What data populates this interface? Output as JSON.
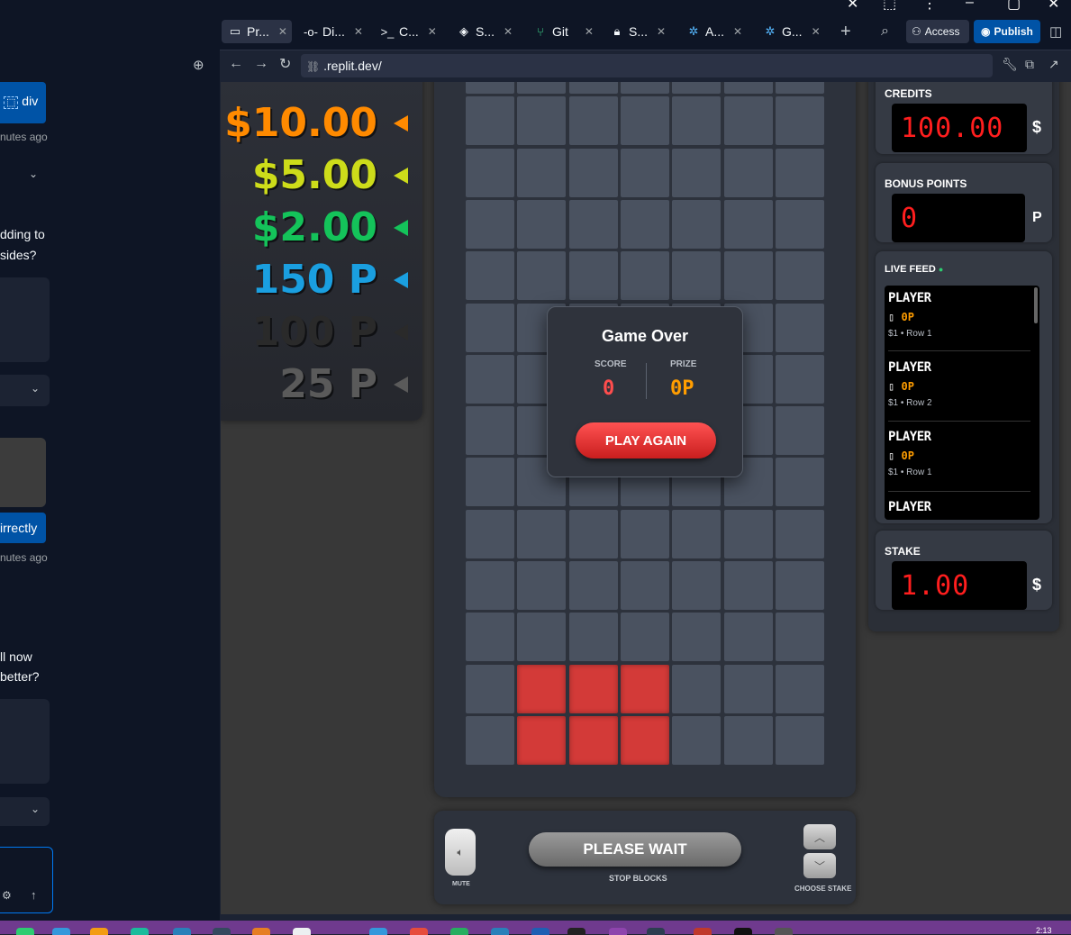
{
  "left_panel": {
    "element_chip": "div",
    "timestamp_1": "nutes ago",
    "message_1_line1": "dding to",
    "message_1_line2": "sides?",
    "reply_button": "irrectly",
    "timestamp_2": "nutes ago",
    "message_2_line1": "ll now",
    "message_2_line2": "better?"
  },
  "tabs": [
    {
      "label": "Pr...",
      "icon": "monitor-icon",
      "active": true
    },
    {
      "label": "Di...",
      "icon": "commit-icon"
    },
    {
      "label": "C...",
      "icon": "terminal-icon"
    },
    {
      "label": "S...",
      "icon": "shield-icon"
    },
    {
      "label": "Git",
      "icon": "git-icon"
    },
    {
      "label": "S...",
      "icon": "lock-icon"
    },
    {
      "label": "A...",
      "icon": "gear-icon"
    },
    {
      "label": "G...",
      "icon": "gear-icon"
    }
  ],
  "header": {
    "access_label": "Access",
    "publish_label": "Publish"
  },
  "address": {
    "url": ".replit.dev/"
  },
  "prizes": [
    {
      "label": "$10.00",
      "color": "#ff8a00"
    },
    {
      "label": "$5.00",
      "color": "#cddc1a"
    },
    {
      "label": "$2.00",
      "color": "#14c35a"
    },
    {
      "label": "150 P",
      "color": "#1a9fe0"
    },
    {
      "label": "100 P",
      "color": "#2a2a2a"
    },
    {
      "label": "25 P",
      "color": "#5a5a5a"
    }
  ],
  "board": {
    "cols": 7,
    "rows": 14,
    "lit_cells": [
      [
        12,
        1
      ],
      [
        12,
        2
      ],
      [
        12,
        3
      ],
      [
        13,
        1
      ],
      [
        13,
        2
      ],
      [
        13,
        3
      ]
    ]
  },
  "game_over": {
    "title": "Game Over",
    "score_label": "SCORE",
    "score_value": "0",
    "prize_label": "PRIZE",
    "prize_value": "0P",
    "play_again": "PLAY AGAIN"
  },
  "sidebar": {
    "credits_label": "CREDITS",
    "credits_value": "100.00",
    "credits_unit": "$",
    "bonus_label": "BONUS POINTS",
    "bonus_value": "0",
    "bonus_unit": "P",
    "feed_label": "LIVE FEED",
    "feed": [
      {
        "player": "PLAYER",
        "prize": "0P",
        "detail": "$1 • Row 1"
      },
      {
        "player": "PLAYER",
        "prize": "0P",
        "detail": "$1 • Row 2"
      },
      {
        "player": "PLAYER",
        "prize": "0P",
        "detail": "$1 • Row 1"
      },
      {
        "player": "PLAYER",
        "prize": "",
        "detail": ""
      }
    ],
    "stake_label": "STAKE",
    "stake_value": "1.00",
    "stake_unit": "$"
  },
  "controls": {
    "mute_label": "MUTE",
    "wait_label": "PLEASE WAIT",
    "stop_label": "STOP BLOCKS",
    "stake_choose": "CHOOSE STAKE"
  },
  "taskbar": {
    "clock": "2:13"
  }
}
